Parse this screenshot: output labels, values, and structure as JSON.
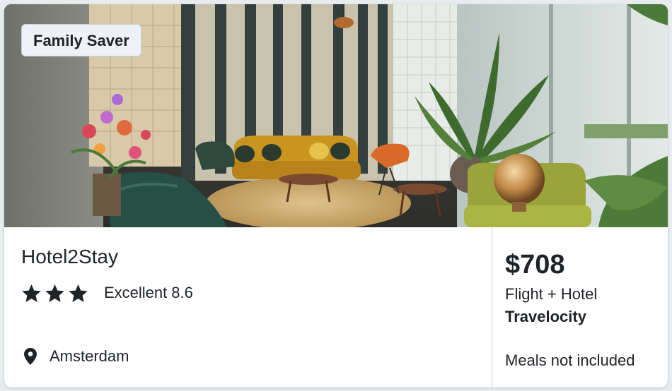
{
  "card": {
    "badge": "Family Saver",
    "hotel_name": "Hotel2Stay",
    "star_count": 3,
    "rating_label": "Excellent",
    "rating_score": "8.6",
    "location": "Amsterdam",
    "price": "$708",
    "package_type": "Flight + Hotel",
    "provider": "Travelocity",
    "meals": "Meals not included"
  },
  "icons": {
    "star": "star-icon",
    "location": "map-pin-icon"
  },
  "colors": {
    "text": "#1f2328",
    "badge_bg": "#eef1f5",
    "divider": "#cfd6dc"
  }
}
